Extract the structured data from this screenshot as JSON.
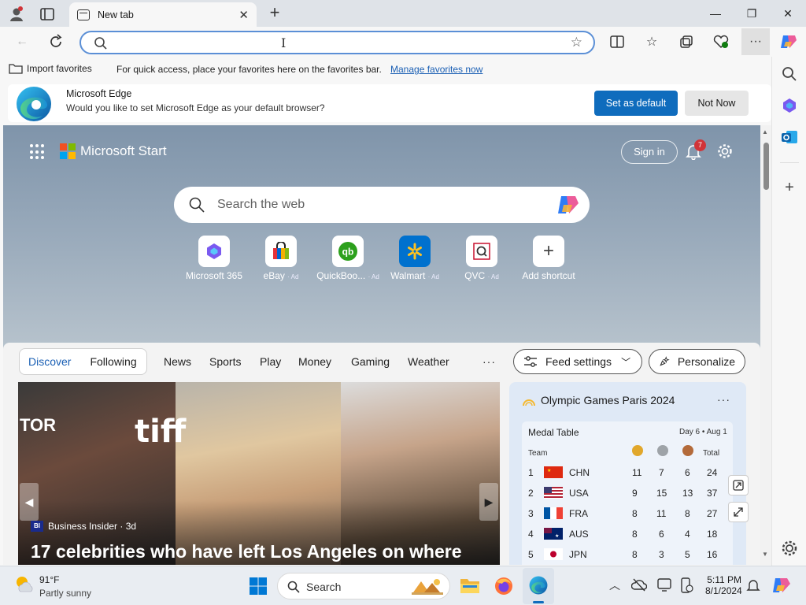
{
  "browser": {
    "tab_title": "New tab",
    "favorites_bar": {
      "import_label": "Import favorites",
      "message": "For quick access, place your favorites here on the favorites bar.",
      "manage_link": "Manage favorites now"
    },
    "banner": {
      "name": "Microsoft Edge",
      "question": "Would you like to set Microsoft Edge as your default browser?",
      "set_default": "Set as default",
      "not_now": "Not Now"
    }
  },
  "start": {
    "brand": "Microsoft Start",
    "sign_in": "Sign in",
    "notification_count": "7",
    "search_placeholder": "Search the web",
    "shortcuts": [
      {
        "label": "Microsoft 365",
        "ad": ""
      },
      {
        "label": "eBay",
        "ad": "· Ad"
      },
      {
        "label": "QuickBoo...",
        "ad": "· Ad"
      },
      {
        "label": "Walmart",
        "ad": "· Ad"
      },
      {
        "label": "QVC",
        "ad": "· Ad"
      },
      {
        "label": "Add shortcut",
        "ad": ""
      }
    ],
    "feed_tabs": {
      "discover": "Discover",
      "following": "Following",
      "nav": [
        "News",
        "Sports",
        "Play",
        "Money",
        "Gaming",
        "Weather"
      ],
      "more": "···",
      "feed_settings": "Feed settings",
      "personalize": "Personalize"
    },
    "hero": {
      "source": "Business Insider · 3d",
      "source_logo": "BI",
      "headline": "17 celebrities who have left Los Angeles on where",
      "overlay_tiff": "tiff",
      "overlay_tor": "TOR"
    },
    "olympics": {
      "title": "Olympic Games Paris 2024",
      "card_title": "Medal Table",
      "day": "Day 6 • Aug 1",
      "col_team": "Team",
      "col_total": "Total",
      "rows": [
        {
          "rank": "1",
          "team": "CHN",
          "gold": "11",
          "silver": "7",
          "bronze": "6",
          "total": "24"
        },
        {
          "rank": "2",
          "team": "USA",
          "gold": "9",
          "silver": "15",
          "bronze": "13",
          "total": "37"
        },
        {
          "rank": "3",
          "team": "FRA",
          "gold": "8",
          "silver": "11",
          "bronze": "8",
          "total": "27"
        },
        {
          "rank": "4",
          "team": "AUS",
          "gold": "8",
          "silver": "6",
          "bronze": "4",
          "total": "18"
        },
        {
          "rank": "5",
          "team": "JPN",
          "gold": "8",
          "silver": "3",
          "bronze": "5",
          "total": "16"
        }
      ]
    }
  },
  "taskbar": {
    "temperature": "91°F",
    "condition": "Partly sunny",
    "search_label": "Search",
    "time": "5:11 PM",
    "date": "8/1/2024"
  },
  "colors": {
    "accent": "#0f6cbd",
    "link": "#1a5fb4",
    "badge": "#d13438"
  }
}
